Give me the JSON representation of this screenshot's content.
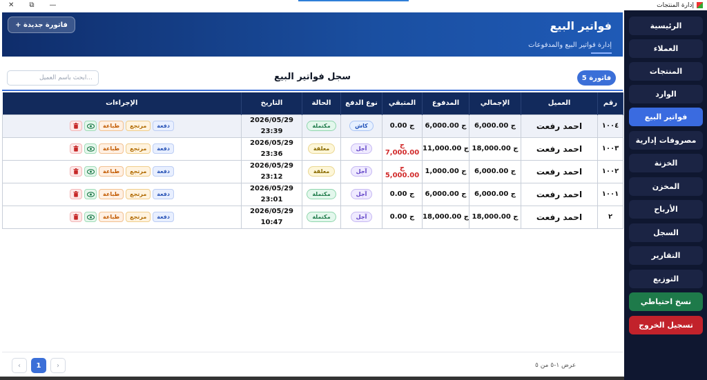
{
  "window": {
    "title": "إدارة المنتجات",
    "controls": [
      "✕",
      "⧉",
      "—"
    ]
  },
  "sidebar": {
    "items": [
      {
        "label": "الرئيسية",
        "state": "normal"
      },
      {
        "label": "العملاء",
        "state": "normal"
      },
      {
        "label": "المنتجات",
        "state": "normal"
      },
      {
        "label": "الوارد",
        "state": "normal"
      },
      {
        "label": "فواتير البيع",
        "state": "active"
      },
      {
        "label": "مصروفات إدارية",
        "state": "normal"
      },
      {
        "label": "الخزنة",
        "state": "normal"
      },
      {
        "label": "المخزن",
        "state": "normal"
      },
      {
        "label": "الأرباح",
        "state": "normal"
      },
      {
        "label": "السجل",
        "state": "normal"
      },
      {
        "label": "التقارير",
        "state": "normal"
      },
      {
        "label": "التوزيع",
        "state": "normal"
      }
    ],
    "backup_label": "نسخ احتياطي",
    "logout_label": "تسجيل الخروج"
  },
  "header": {
    "title": "فواتير البيع",
    "subtitle": "إدارة فواتير البيع والمدفوعات",
    "new_invoice_label": "+ فاتورة جديدة"
  },
  "records": {
    "title": "سجل فواتير البيع",
    "count_badge": "5 فاتورة",
    "search_placeholder": "...ابحث باسم العميل"
  },
  "table": {
    "columns": [
      "رقم",
      "العميل",
      "الإجمالي",
      "المدفوع",
      "المتبقي",
      "نوع الدفع",
      "الحالة",
      "التاريخ",
      "الإجراءات"
    ],
    "action_labels": {
      "pay": "دفعة",
      "return": "مرتجع",
      "print": "طباعة"
    },
    "rows": [
      {
        "id": "١٠٠٤",
        "customer": "احمد رفعت",
        "total": "ج 6,000.00",
        "paid": "ج 6,000.00",
        "remaining": "ج 0.00",
        "remaining_negative": false,
        "payment_type": "كاش",
        "payment_kind": "cash",
        "status": "مكتملة",
        "status_kind": "done",
        "date": "2026/05/29",
        "time": "23:39"
      },
      {
        "id": "١٠٠٣",
        "customer": "احمد رفعت",
        "total": "ج 18,000.00",
        "paid": "ج 11,000.00",
        "remaining": "ج 7,000.00",
        "remaining_negative": true,
        "payment_type": "آجل",
        "payment_kind": "later",
        "status": "معلقة",
        "status_kind": "hold",
        "date": "2026/05/29",
        "time": "23:36"
      },
      {
        "id": "١٠٠٢",
        "customer": "احمد رفعت",
        "total": "ج 6,000.00",
        "paid": "ج 1,000.00",
        "remaining": "ج 5,000.00",
        "remaining_negative": true,
        "payment_type": "آجل",
        "payment_kind": "later",
        "status": "معلقة",
        "status_kind": "hold",
        "date": "2026/05/29",
        "time": "23:12"
      },
      {
        "id": "١٠٠١",
        "customer": "احمد رفعت",
        "total": "ج 6,000.00",
        "paid": "ج 6,000.00",
        "remaining": "ج 0.00",
        "remaining_negative": false,
        "payment_type": "آجل",
        "payment_kind": "later",
        "status": "مكتملة",
        "status_kind": "done",
        "date": "2026/05/29",
        "time": "23:01"
      },
      {
        "id": "٢",
        "customer": "احمد رفعت",
        "total": "ج 18,000.00",
        "paid": "ج 18,000.00",
        "remaining": "ج 0.00",
        "remaining_negative": false,
        "payment_type": "آجل",
        "payment_kind": "later",
        "status": "مكتملة",
        "status_kind": "done",
        "date": "2026/05/29",
        "time": "10:47"
      }
    ]
  },
  "footer": {
    "range_text": "عرض ١-٥ من ٥",
    "current_page": "1",
    "prev_label": "‹",
    "next_label": "›"
  },
  "colors": {
    "sidebar_bg": "#0f1730",
    "active": "#3a6be0",
    "header_dark": "#122a5c",
    "danger": "#c2222b",
    "success": "#1e7a4a"
  }
}
